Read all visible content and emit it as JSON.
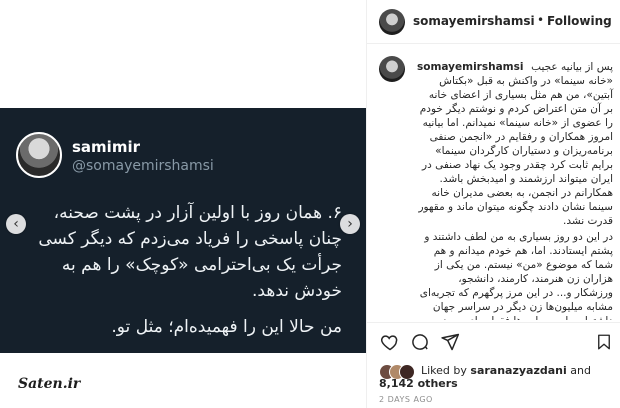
{
  "tweet": {
    "name": "samimir",
    "handle": "@somayemirshamsi",
    "paragraphs": [
      "۶. همان روز با اولین آزار در پشت صحنه، چنان پاسخی را فریاد می‌زدم که دیگر کسی جرأت یک بی‌احترامی «کوچک» را هم به خودش ندهد.",
      "من حالا این را فهمیده‌ام؛ مثل تو."
    ]
  },
  "watermark": "Saten.ir",
  "post_header": {
    "username": "somayemirshamsi",
    "separator": "•",
    "follow_status": "Following"
  },
  "caption": {
    "username": "somayemirshamsi",
    "paragraphs": [
      "پس از بیانیه عجیب «خانه سینما» در واکنش به قبل «بکتاش آبتین»، من هم مثل بسیاری از اعضای خانه بر آن متن اعتراض کردم و نوشتم دیگر خودم را عضوی از «خانه سینما» نمیدانم. اما بیانیه امروز همکاران و رفقایم در «انجمن صنفی برنامه‌ریزان و دستیاران کارگردان سینما» برایم ثابت کرد چقدر وجود یک نهاد صنفی در ایران میتواند ارزشمند و امیدبخش باشد. همکارانم در انجمن، به بعضی مدیران خانه سینما نشان دادند چگونه میتوان ماند و مقهور قدرت نشد.",
      "در این دو روز بسیاری به من لطف داشتند و پشتم ایستادند. اما، هم خودم میدانم و هم شما که موضوع «من» نیستم. من یکی از هزاران زن هنرمند، کارمند، دانشجو، ورزشکار و... در این مرز پرگهرم که تجربه‌ای مشابه میلیون‌ها زن دیگر در سراسر جهان داشته‌ایم. این حمایت‌ها فقط برای من نیست، برای تو است؛ تویی که از من آزار دیدهای، یا مثل او آزار داده‌ای، یا مثل آن یکی چشمانت را بسته‌ای. این حمایت‌ها یعنی «ما همدیگر"
    ]
  },
  "actions": {
    "like_icon": "heart-icon",
    "comment_icon": "comment-icon",
    "share_icon": "share-icon",
    "save_icon": "bookmark-icon"
  },
  "likes": {
    "prefix": "Liked by",
    "first_user": "saranazyazdani",
    "joiner": "and",
    "others": "8,142 others"
  },
  "timestamp": "2 DAYS AGO"
}
